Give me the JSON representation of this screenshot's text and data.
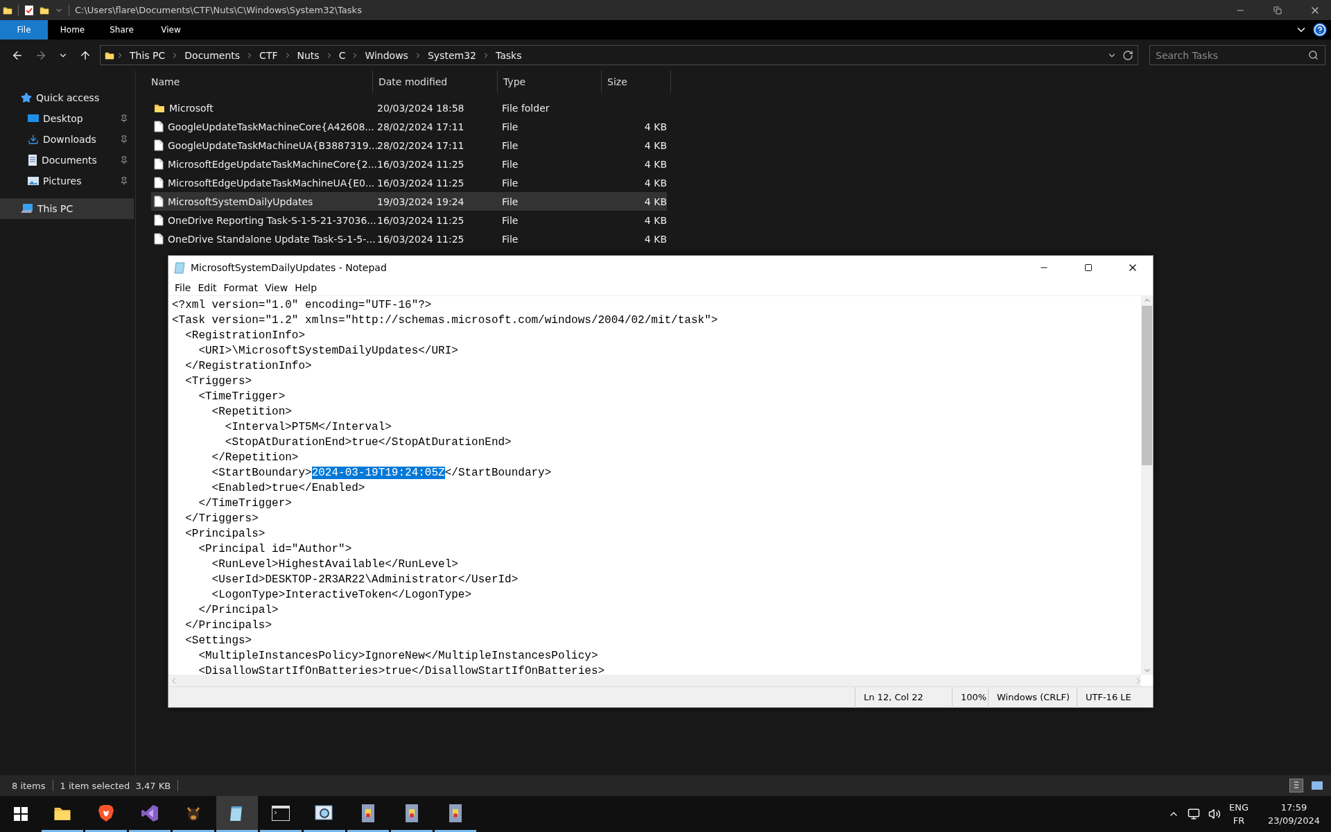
{
  "explorer": {
    "title": "C:\\Users\\flare\\Documents\\CTF\\Nuts\\C\\Windows\\System32\\Tasks",
    "ribbon_tabs": [
      {
        "label": "File",
        "selected": true
      },
      {
        "label": "Home",
        "selected": false
      },
      {
        "label": "Share",
        "selected": false
      },
      {
        "label": "View",
        "selected": false
      }
    ],
    "breadcrumb": [
      "This PC",
      "Documents",
      "CTF",
      "Nuts",
      "C",
      "Windows",
      "System32",
      "Tasks"
    ],
    "search": {
      "placeholder": "Search Tasks"
    },
    "sidebar": [
      {
        "label": "Quick access",
        "kind": "star",
        "pinned": false,
        "selected": false
      },
      {
        "label": "Desktop",
        "kind": "desktop",
        "pinned": true,
        "selected": false
      },
      {
        "label": "Downloads",
        "kind": "download",
        "pinned": true,
        "selected": false
      },
      {
        "label": "Documents",
        "kind": "documents",
        "pinned": true,
        "selected": false
      },
      {
        "label": "Pictures",
        "kind": "pictures",
        "pinned": true,
        "selected": false
      },
      {
        "label": "This PC",
        "kind": "pc",
        "pinned": false,
        "selected": true
      }
    ],
    "columns": [
      "Name",
      "Date modified",
      "Type",
      "Size"
    ],
    "rows": [
      {
        "kind": "folder",
        "name": "Microsoft",
        "date": "20/03/2024 18:58",
        "type": "File folder",
        "selected": false
      },
      {
        "kind": "file",
        "name": "GoogleUpdateTaskMachineCore{A42608...",
        "date": "28/02/2024 17:11",
        "type": "File",
        "size": "4 KB",
        "selected": false
      },
      {
        "kind": "file",
        "name": "GoogleUpdateTaskMachineUA{B3887319...",
        "date": "28/02/2024 17:11",
        "type": "File",
        "size": "4 KB",
        "selected": false
      },
      {
        "kind": "file",
        "name": "MicrosoftEdgeUpdateTaskMachineCore{2...",
        "date": "16/03/2024 11:25",
        "type": "File",
        "size": "4 KB",
        "selected": false
      },
      {
        "kind": "file",
        "name": "MicrosoftEdgeUpdateTaskMachineUA{E0...",
        "date": "16/03/2024 11:25",
        "type": "File",
        "size": "4 KB",
        "selected": false
      },
      {
        "kind": "file",
        "name": "MicrosoftSystemDailyUpdates",
        "date": "19/03/2024 19:24",
        "type": "File",
        "size": "4 KB",
        "selected": true
      },
      {
        "kind": "file",
        "name": "OneDrive Reporting Task-S-1-5-21-37036...",
        "date": "16/03/2024 11:25",
        "type": "File",
        "size": "4 KB",
        "selected": false
      },
      {
        "kind": "file",
        "name": "OneDrive Standalone Update Task-S-1-5-...",
        "date": "16/03/2024 11:25",
        "type": "File",
        "size": "4 KB",
        "selected": false
      }
    ],
    "status": {
      "count": "8 items",
      "selection": "1 item selected  3,47 KB"
    }
  },
  "notepad": {
    "title": "MicrosoftSystemDailyUpdates - Notepad",
    "menu": [
      "File",
      "Edit",
      "Format",
      "View",
      "Help"
    ],
    "lines": [
      {
        "kind": "text",
        "text": "<?xml version=\"1.0\" encoding=\"UTF-16\"?>"
      },
      {
        "kind": "text",
        "text": "<Task version=\"1.2\" xmlns=\"http://schemas.microsoft.com/windows/2004/02/mit/task\">"
      },
      {
        "kind": "text",
        "text": "  <RegistrationInfo>"
      },
      {
        "kind": "text",
        "text": "    <URI>\\MicrosoftSystemDailyUpdates</URI>"
      },
      {
        "kind": "text",
        "text": "  </RegistrationInfo>"
      },
      {
        "kind": "text",
        "text": "  <Triggers>"
      },
      {
        "kind": "text",
        "text": "    <TimeTrigger>"
      },
      {
        "kind": "text",
        "text": "      <Repetition>"
      },
      {
        "kind": "text",
        "text": "        <Interval>PT5M</Interval>"
      },
      {
        "kind": "text",
        "text": "        <StopAtDurationEnd>true</StopAtDurationEnd>"
      },
      {
        "kind": "text",
        "text": "      </Repetition>"
      },
      {
        "kind": "selection",
        "text": "      <StartBoundary>",
        "selected_text": "2024-03-19T19:24:05Z",
        "after": "</StartBoundary>"
      },
      {
        "kind": "text",
        "text": "      <Enabled>true</Enabled>"
      },
      {
        "kind": "text",
        "text": "    </TimeTrigger>"
      },
      {
        "kind": "text",
        "text": "  </Triggers>"
      },
      {
        "kind": "text",
        "text": "  <Principals>"
      },
      {
        "kind": "text",
        "text": "    <Principal id=\"Author\">"
      },
      {
        "kind": "text",
        "text": "      <RunLevel>HighestAvailable</RunLevel>"
      },
      {
        "kind": "text",
        "text": "      <UserId>DESKTOP-2R3AR22\\Administrator</UserId>"
      },
      {
        "kind": "text",
        "text": "      <LogonType>InteractiveToken</LogonType>"
      },
      {
        "kind": "text",
        "text": "    </Principal>"
      },
      {
        "kind": "text",
        "text": "  </Principals>"
      },
      {
        "kind": "text",
        "text": "  <Settings>"
      },
      {
        "kind": "text",
        "text": "    <MultipleInstancesPolicy>IgnoreNew</MultipleInstancesPolicy>"
      },
      {
        "kind": "text",
        "text": "    <DisallowStartIfOnBatteries>true</DisallowStartIfOnBatteries>"
      }
    ],
    "status": [
      "Ln 12, Col 22",
      "100%",
      "Windows (CRLF)",
      "UTF-16 LE"
    ]
  },
  "taskbar": {
    "apps": [
      {
        "kind": "explorer",
        "selected": false
      },
      {
        "kind": "lion",
        "selected": false
      },
      {
        "kind": "ribbon",
        "selected": false
      },
      {
        "kind": "bug",
        "selected": false
      },
      {
        "kind": "notepad",
        "selected": true
      },
      {
        "kind": "terminal",
        "selected": false
      },
      {
        "kind": "viewer",
        "selected": false
      },
      {
        "kind": "archive",
        "selected": false
      },
      {
        "kind": "archive",
        "selected": false
      },
      {
        "kind": "archive",
        "selected": false
      }
    ],
    "language": "ENG",
    "layout": "FR",
    "time": "17:59",
    "date": "23/09/2024"
  }
}
